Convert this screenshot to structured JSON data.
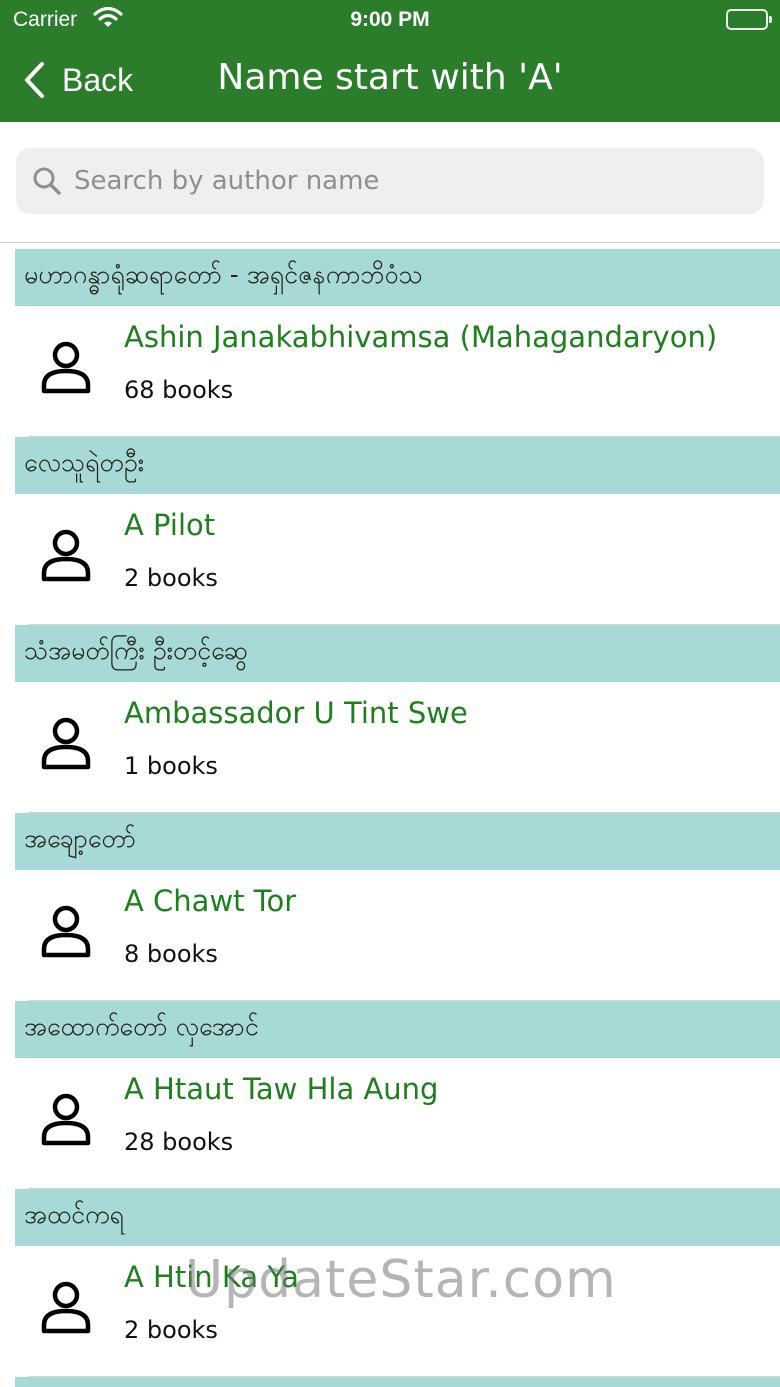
{
  "status_bar": {
    "carrier": "Carrier",
    "time": "9:00 PM"
  },
  "nav": {
    "back_label": "Back",
    "title": "Name start with 'A'"
  },
  "search": {
    "placeholder": "Search by author name"
  },
  "sections": [
    {
      "header": "မဟာဂန္ဓာရုံဆရာတော် - အရှင်ဇနကာဘိဝံသ",
      "name": "Ashin Janakabhivamsa (Mahagandaryon)",
      "count": "68 books"
    },
    {
      "header": "လေသူရဲတဦး",
      "name": "A Pilot",
      "count": "2 books"
    },
    {
      "header": "သံအမတ်ကြီး ဦးတင့်ဆွေ",
      "name": "Ambassador U Tint Swe",
      "count": "1 books"
    },
    {
      "header": "အချော့တော်",
      "name": "A Chawt Tor",
      "count": "8 books"
    },
    {
      "header": "အထောက်တော် လှအောင်",
      "name": "A Htaut Taw Hla Aung",
      "count": "28 books"
    },
    {
      "header": "အထင်ကရ",
      "name": "A Htin Ka Ya",
      "count": "2 books"
    }
  ],
  "watermark": "UpdateStar.com",
  "colors": {
    "nav_bar": "#2b7d2b",
    "section_header": "#a7dad6",
    "author_name": "#1f7f1f"
  }
}
